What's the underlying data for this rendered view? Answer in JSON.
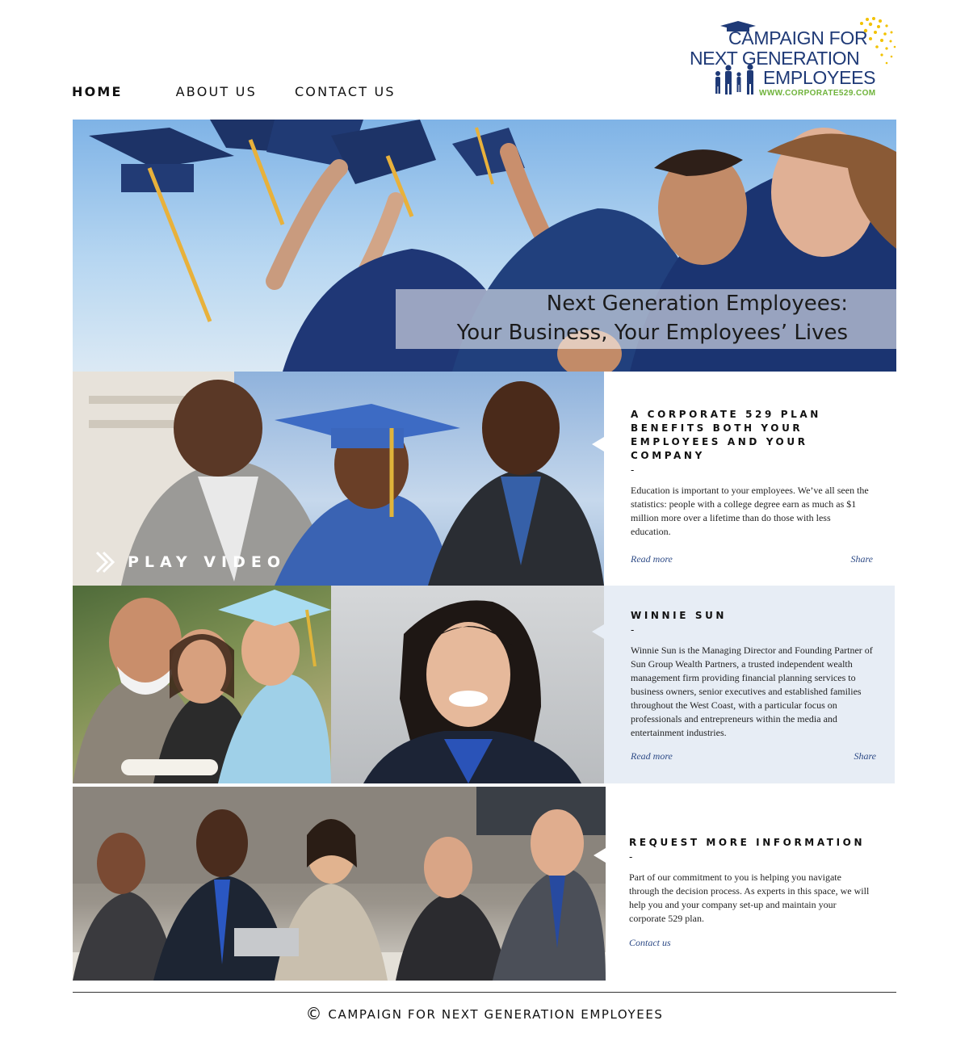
{
  "nav": {
    "home": "HOME",
    "about": "ABOUT US",
    "contact": "CONTACT US"
  },
  "logo": {
    "line1": "CAMPAIGN FOR",
    "line2": "NEXT GENERATION",
    "line3": "EMPLOYEES",
    "url": "WWW.CORPORATE529.COM"
  },
  "hero": {
    "title_line1": "Next Generation Employees:",
    "title_line2": "Your Business, Your Employees’ Lives"
  },
  "video": {
    "play_label": "PLAY VIDEO"
  },
  "sections": [
    {
      "heading": "A CORPORATE 529 PLAN BENEFITS BOTH YOUR EMPLOYEES AND YOUR COMPANY",
      "dash": "-",
      "body": "Education is important to your employees. We’ve all seen the statistics: people with a college degree earn as much as $1 million more over a lifetime than do those with less education.",
      "read_more": "Read more",
      "share": "Share"
    },
    {
      "heading": "WINNIE SUN",
      "dash": "-",
      "body": "Winnie Sun is the Managing Director and Founding Partner of Sun Group Wealth Partners, a trusted independent wealth management firm providing financial planning services to business owners, senior executives and established families throughout the West Coast, with a particular focus on professionals and entrepreneurs within the media and entertainment industries.",
      "read_more": "Read more",
      "share": "Share"
    },
    {
      "heading": "REQUEST MORE INFORMATION",
      "dash": "-",
      "body": "Part of our commitment to you is helping you navigate through the decision process. As experts in this space, we will help you and your company set-up and maintain your corporate 529 plan.",
      "contact_link": "Contact us"
    }
  ],
  "footer": {
    "copyright_symbol": "©",
    "text": "CAMPAIGN FOR NEXT GENERATION EMPLOYEES"
  }
}
